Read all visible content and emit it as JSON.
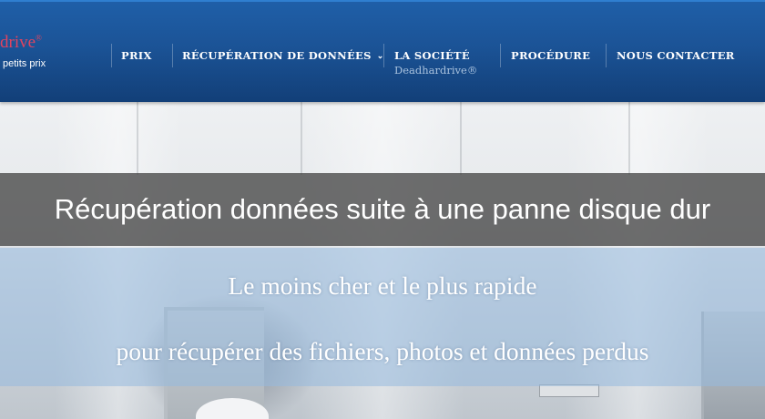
{
  "logo": {
    "brand": "drive",
    "trademark": "®",
    "tagline": "petits prix"
  },
  "nav": {
    "items": [
      {
        "label": "PRIX"
      },
      {
        "label": "RÉCUPÉRATION DE DONNÉES",
        "has_dropdown": true,
        "dropdown_icon": "chevron-down-icon"
      },
      {
        "label": "LA SOCIÉTÉ",
        "sublabel": "Deadhardrive®"
      },
      {
        "label": "PROCÉDURE"
      },
      {
        "label": "NOUS CONTACTER"
      }
    ]
  },
  "hero": {
    "title": "Récupération données suite à une panne disque dur",
    "tagline_line1": "Le moins cher et le plus rapide",
    "tagline_line2": "pour récupérer des fichiers, photos et données perdus"
  },
  "colors": {
    "header": "#1b5396",
    "brand": "#e0445f",
    "title_band": "#464646",
    "tagline_band": "#96b9de"
  }
}
